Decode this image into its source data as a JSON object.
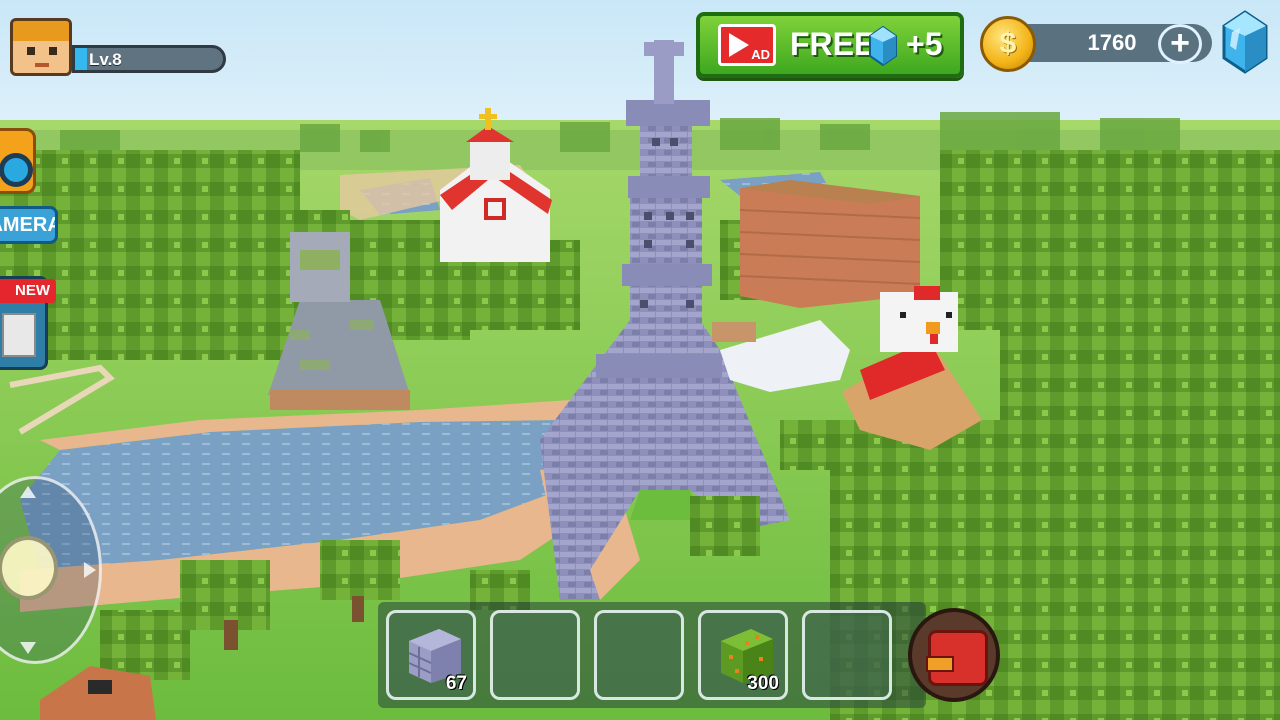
{
  "player": {
    "level_label": "Lv.8",
    "level_progress": 0.08
  },
  "left_panel": {
    "camera_label": "CAMERA",
    "new_badge": "NEW"
  },
  "offer": {
    "ad_label": "AD",
    "free_label": "FREE",
    "bonus_label": "+5",
    "icon": "video-ad-icon"
  },
  "currency": {
    "coins": "1760",
    "coin_icon": "gold-coin-icon",
    "gem_icon": "blue-gem-icon",
    "add_icon": "plus-icon"
  },
  "hotbar": {
    "slots": [
      {
        "item": "stone-brick-block",
        "count": "67"
      },
      {
        "item": "",
        "count": ""
      },
      {
        "item": "",
        "count": ""
      },
      {
        "item": "leaf-block",
        "count": "300"
      },
      {
        "item": "",
        "count": ""
      }
    ],
    "backpack_icon": "backpack-icon"
  },
  "colors": {
    "grass": "#7cc94a",
    "water": "#7fa4c6",
    "path": "#e8b78e",
    "tower": "#8f90b8",
    "hud_green": "#4fbf2a",
    "coin_gold": "#f3b316"
  }
}
